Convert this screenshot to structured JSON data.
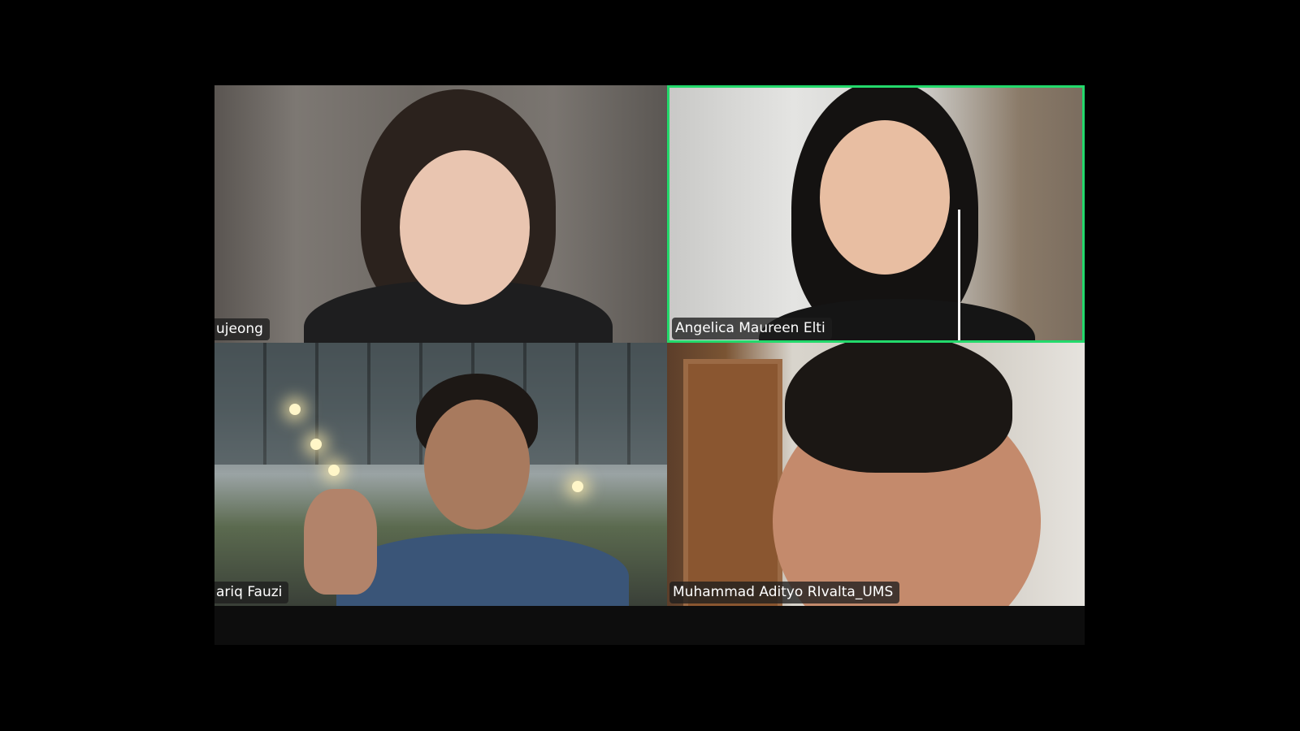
{
  "meeting": {
    "participants": [
      {
        "name": "ujeong",
        "active_speaker": false
      },
      {
        "name": "Angelica Maureen Elti",
        "active_speaker": true
      },
      {
        "name": "ariq Fauzi",
        "active_speaker": false
      },
      {
        "name": "Muhammad Adityo RIvalta_UMS",
        "active_speaker": false
      }
    ]
  },
  "colors": {
    "background": "#000000",
    "active_speaker_border": "#23d96b",
    "name_label_bg": "#1e1e1e"
  }
}
